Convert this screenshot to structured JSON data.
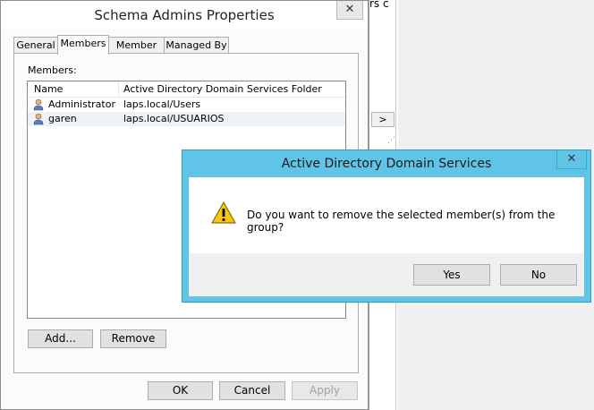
{
  "background_window": {
    "fragment_text": "rs c",
    "scroll_arrow": ">"
  },
  "properties_window": {
    "title": "Schema Admins Properties",
    "close_glyph": "✕",
    "tabs": [
      {
        "label": "General",
        "active": false
      },
      {
        "label": "Members",
        "active": true
      },
      {
        "label": "Member Of",
        "active": false
      },
      {
        "label": "Managed By",
        "active": false
      }
    ],
    "members_label": "Members:",
    "columns": [
      "Name",
      "Active Directory Domain Services Folder"
    ],
    "rows": [
      {
        "name": "Administrator",
        "folder": "laps.local/Users"
      },
      {
        "name": "garen",
        "folder": "laps.local/USUARIOS"
      }
    ],
    "add_label": "Add...",
    "remove_label": "Remove",
    "ok_label": "OK",
    "cancel_label": "Cancel",
    "apply_label": "Apply"
  },
  "dialog": {
    "title": "Active Directory Domain Services",
    "close_glyph": "✕",
    "icon": "warning-icon",
    "message": "Do you want to remove the selected member(s) from the group?",
    "yes_label": "Yes",
    "no_label": "No",
    "accent": "#5fc4e6"
  }
}
